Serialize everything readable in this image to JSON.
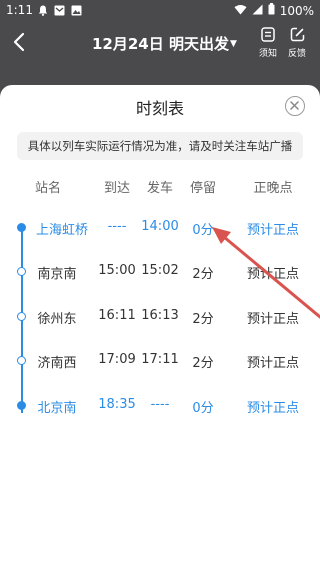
{
  "status_bar": {
    "time": "1:11",
    "battery": "100%",
    "icons": [
      "notification-icon",
      "mail-icon",
      "image-icon",
      "wifi-icon",
      "signal-icon",
      "battery-icon"
    ]
  },
  "header": {
    "title": "12月24日 明天出发",
    "notice_label": "须知",
    "feedback_label": "反馈"
  },
  "sheet": {
    "title": "时刻表",
    "notice": "具体以列车实际运行情况为准，请及时关注车站广播",
    "columns": [
      "站名",
      "到达",
      "发车",
      "停留",
      "正晚点"
    ],
    "rows": [
      {
        "station": "上海虹桥",
        "arrive": "----",
        "depart": "14:00",
        "stop": "0分",
        "status": "预计正点",
        "highlight": true
      },
      {
        "station": "南京南",
        "arrive": "15:00",
        "depart": "15:02",
        "stop": "2分",
        "status": "预计正点",
        "highlight": false
      },
      {
        "station": "徐州东",
        "arrive": "16:11",
        "depart": "16:13",
        "stop": "2分",
        "status": "预计正点",
        "highlight": false
      },
      {
        "station": "济南西",
        "arrive": "17:09",
        "depart": "17:11",
        "stop": "2分",
        "status": "预计正点",
        "highlight": false
      },
      {
        "station": "北京南",
        "arrive": "18:35",
        "depart": "----",
        "stop": "0分",
        "status": "预计正点",
        "highlight": true
      }
    ]
  },
  "colors": {
    "accent": "#2b8ce6",
    "annotation_arrow": "#d9534f",
    "overlay": "#4a4a4c"
  }
}
